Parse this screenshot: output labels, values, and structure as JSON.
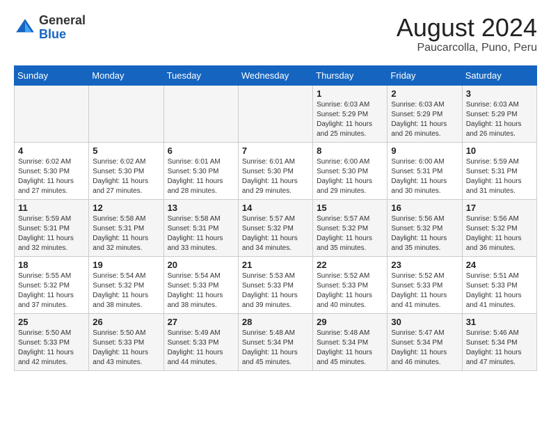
{
  "header": {
    "logo": {
      "general": "General",
      "blue": "Blue"
    },
    "title": "August 2024",
    "location": "Paucarcolla, Puno, Peru"
  },
  "calendar": {
    "weekdays": [
      "Sunday",
      "Monday",
      "Tuesday",
      "Wednesday",
      "Thursday",
      "Friday",
      "Saturday"
    ],
    "weeks": [
      [
        {
          "day": "",
          "sunrise": "",
          "sunset": "",
          "daylight": ""
        },
        {
          "day": "",
          "sunrise": "",
          "sunset": "",
          "daylight": ""
        },
        {
          "day": "",
          "sunrise": "",
          "sunset": "",
          "daylight": ""
        },
        {
          "day": "",
          "sunrise": "",
          "sunset": "",
          "daylight": ""
        },
        {
          "day": "1",
          "sunrise": "Sunrise: 6:03 AM",
          "sunset": "Sunset: 5:29 PM",
          "daylight": "Daylight: 11 hours and 25 minutes."
        },
        {
          "day": "2",
          "sunrise": "Sunrise: 6:03 AM",
          "sunset": "Sunset: 5:29 PM",
          "daylight": "Daylight: 11 hours and 26 minutes."
        },
        {
          "day": "3",
          "sunrise": "Sunrise: 6:03 AM",
          "sunset": "Sunset: 5:29 PM",
          "daylight": "Daylight: 11 hours and 26 minutes."
        }
      ],
      [
        {
          "day": "4",
          "sunrise": "Sunrise: 6:02 AM",
          "sunset": "Sunset: 5:30 PM",
          "daylight": "Daylight: 11 hours and 27 minutes."
        },
        {
          "day": "5",
          "sunrise": "Sunrise: 6:02 AM",
          "sunset": "Sunset: 5:30 PM",
          "daylight": "Daylight: 11 hours and 27 minutes."
        },
        {
          "day": "6",
          "sunrise": "Sunrise: 6:01 AM",
          "sunset": "Sunset: 5:30 PM",
          "daylight": "Daylight: 11 hours and 28 minutes."
        },
        {
          "day": "7",
          "sunrise": "Sunrise: 6:01 AM",
          "sunset": "Sunset: 5:30 PM",
          "daylight": "Daylight: 11 hours and 29 minutes."
        },
        {
          "day": "8",
          "sunrise": "Sunrise: 6:00 AM",
          "sunset": "Sunset: 5:30 PM",
          "daylight": "Daylight: 11 hours and 29 minutes."
        },
        {
          "day": "9",
          "sunrise": "Sunrise: 6:00 AM",
          "sunset": "Sunset: 5:31 PM",
          "daylight": "Daylight: 11 hours and 30 minutes."
        },
        {
          "day": "10",
          "sunrise": "Sunrise: 5:59 AM",
          "sunset": "Sunset: 5:31 PM",
          "daylight": "Daylight: 11 hours and 31 minutes."
        }
      ],
      [
        {
          "day": "11",
          "sunrise": "Sunrise: 5:59 AM",
          "sunset": "Sunset: 5:31 PM",
          "daylight": "Daylight: 11 hours and 32 minutes."
        },
        {
          "day": "12",
          "sunrise": "Sunrise: 5:58 AM",
          "sunset": "Sunset: 5:31 PM",
          "daylight": "Daylight: 11 hours and 32 minutes."
        },
        {
          "day": "13",
          "sunrise": "Sunrise: 5:58 AM",
          "sunset": "Sunset: 5:31 PM",
          "daylight": "Daylight: 11 hours and 33 minutes."
        },
        {
          "day": "14",
          "sunrise": "Sunrise: 5:57 AM",
          "sunset": "Sunset: 5:32 PM",
          "daylight": "Daylight: 11 hours and 34 minutes."
        },
        {
          "day": "15",
          "sunrise": "Sunrise: 5:57 AM",
          "sunset": "Sunset: 5:32 PM",
          "daylight": "Daylight: 11 hours and 35 minutes."
        },
        {
          "day": "16",
          "sunrise": "Sunrise: 5:56 AM",
          "sunset": "Sunset: 5:32 PM",
          "daylight": "Daylight: 11 hours and 35 minutes."
        },
        {
          "day": "17",
          "sunrise": "Sunrise: 5:56 AM",
          "sunset": "Sunset: 5:32 PM",
          "daylight": "Daylight: 11 hours and 36 minutes."
        }
      ],
      [
        {
          "day": "18",
          "sunrise": "Sunrise: 5:55 AM",
          "sunset": "Sunset: 5:32 PM",
          "daylight": "Daylight: 11 hours and 37 minutes."
        },
        {
          "day": "19",
          "sunrise": "Sunrise: 5:54 AM",
          "sunset": "Sunset: 5:32 PM",
          "daylight": "Daylight: 11 hours and 38 minutes."
        },
        {
          "day": "20",
          "sunrise": "Sunrise: 5:54 AM",
          "sunset": "Sunset: 5:33 PM",
          "daylight": "Daylight: 11 hours and 38 minutes."
        },
        {
          "day": "21",
          "sunrise": "Sunrise: 5:53 AM",
          "sunset": "Sunset: 5:33 PM",
          "daylight": "Daylight: 11 hours and 39 minutes."
        },
        {
          "day": "22",
          "sunrise": "Sunrise: 5:52 AM",
          "sunset": "Sunset: 5:33 PM",
          "daylight": "Daylight: 11 hours and 40 minutes."
        },
        {
          "day": "23",
          "sunrise": "Sunrise: 5:52 AM",
          "sunset": "Sunset: 5:33 PM",
          "daylight": "Daylight: 11 hours and 41 minutes."
        },
        {
          "day": "24",
          "sunrise": "Sunrise: 5:51 AM",
          "sunset": "Sunset: 5:33 PM",
          "daylight": "Daylight: 11 hours and 41 minutes."
        }
      ],
      [
        {
          "day": "25",
          "sunrise": "Sunrise: 5:50 AM",
          "sunset": "Sunset: 5:33 PM",
          "daylight": "Daylight: 11 hours and 42 minutes."
        },
        {
          "day": "26",
          "sunrise": "Sunrise: 5:50 AM",
          "sunset": "Sunset: 5:33 PM",
          "daylight": "Daylight: 11 hours and 43 minutes."
        },
        {
          "day": "27",
          "sunrise": "Sunrise: 5:49 AM",
          "sunset": "Sunset: 5:33 PM",
          "daylight": "Daylight: 11 hours and 44 minutes."
        },
        {
          "day": "28",
          "sunrise": "Sunrise: 5:48 AM",
          "sunset": "Sunset: 5:34 PM",
          "daylight": "Daylight: 11 hours and 45 minutes."
        },
        {
          "day": "29",
          "sunrise": "Sunrise: 5:48 AM",
          "sunset": "Sunset: 5:34 PM",
          "daylight": "Daylight: 11 hours and 45 minutes."
        },
        {
          "day": "30",
          "sunrise": "Sunrise: 5:47 AM",
          "sunset": "Sunset: 5:34 PM",
          "daylight": "Daylight: 11 hours and 46 minutes."
        },
        {
          "day": "31",
          "sunrise": "Sunrise: 5:46 AM",
          "sunset": "Sunset: 5:34 PM",
          "daylight": "Daylight: 11 hours and 47 minutes."
        }
      ]
    ]
  }
}
